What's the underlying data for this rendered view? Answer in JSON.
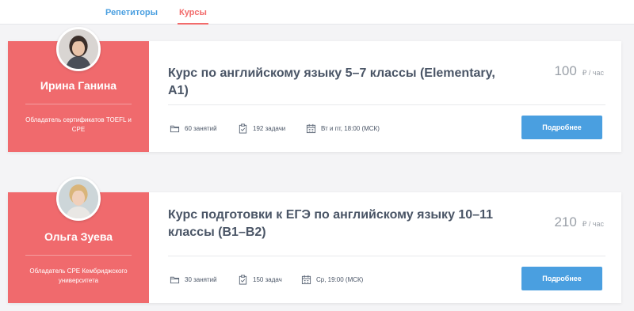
{
  "tabs": [
    {
      "label": "Репетиторы",
      "active": false
    },
    {
      "label": "Курсы",
      "active": true
    }
  ],
  "colors": {
    "accent_red": "#f06a6d",
    "accent_blue": "#4a9fe0",
    "title_text": "#4a5566"
  },
  "courses": [
    {
      "tutor": {
        "name": "Ирина Ганина",
        "description": "Обладатель сертификатов TOEFL и CPE",
        "avatar": "avatar-photo"
      },
      "title": "Курс по английскому языку 5–7 классы (Elementary, A1)",
      "price": {
        "value": "100",
        "unit": "₽ / час"
      },
      "lessons": {
        "icon": "folder-icon",
        "text": "60 занятий"
      },
      "tasks": {
        "icon": "clipboard-icon",
        "text": "192 задачи"
      },
      "schedule": {
        "icon": "calendar-icon",
        "text": "Вт и пт, 18:00 (МСК)"
      },
      "button_label": "Подробнее"
    },
    {
      "tutor": {
        "name": "Ольга Зуева",
        "description": "Обладатель CPE Кембриджского университета",
        "avatar": "avatar-photo"
      },
      "title": "Курс подготовки к ЕГЭ по английскому языку 10–11 классы (B1–B2)",
      "price": {
        "value": "210",
        "unit": "₽ / час"
      },
      "lessons": {
        "icon": "folder-icon",
        "text": "30 занятий"
      },
      "tasks": {
        "icon": "clipboard-icon",
        "text": "150 задач"
      },
      "schedule": {
        "icon": "calendar-icon",
        "text": "Ср, 19:00 (МСК)"
      },
      "button_label": "Подробнее"
    }
  ]
}
